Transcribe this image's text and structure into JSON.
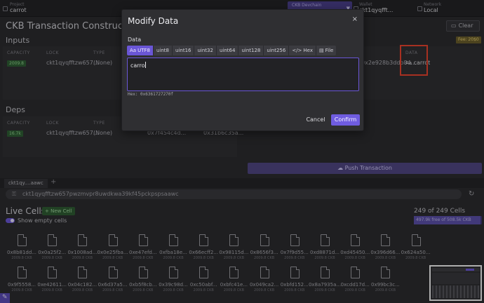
{
  "topbar": {
    "project_label": "Project",
    "project_value": "carrot",
    "connection_label": "CKB Devchain",
    "connection_value": "⋯",
    "wallet_label": "Wallet",
    "wallet_value": "ckt1qyqfft...",
    "network_label": "Network",
    "network_value": "Local"
  },
  "page": {
    "title": "CKB Transaction Constructor",
    "clear_label": "Clear",
    "inputs_label": "Inputs",
    "deps_label": "Deps",
    "fee_badge": "Fee: 20$0",
    "columns": {
      "capacity": "CAPACITY",
      "lock": "LOCK",
      "type": "TYPE",
      "data": "DATA"
    },
    "input_row": {
      "capacity": "2009.8",
      "lock": "ckt1qyqfftzw657...",
      "type": "(None)",
      "hash": "0x2e928b3ddb84...",
      "data_prefix": "Aa",
      "data_value": "carrot"
    },
    "dep_row": {
      "capacity": "16.7k",
      "lock": "ckt1qyqfftzw657...",
      "type": "(None)",
      "hash1": "0x7f454c4d...",
      "hash2": "0x31b6c35a..."
    },
    "push_label": "Push Transaction"
  },
  "explorer": {
    "tab_label": "ckt1qy....aawc",
    "address": "ckt1qyqfftzw657pwzmvpr8uwdkwa39kf45pckpspsaawc",
    "live_cells_title": "Live Cells",
    "new_cell_label": "New Cell",
    "show_empty_label": "Show empty cells",
    "cell_count": "249 of 249 Cells",
    "capacity_text": "497.9k free of 508.5k CKB",
    "capacity_fraction": 0.98,
    "cells_row1": [
      {
        "id": "0x8b81dd...",
        "cap": "2009.8 CKB"
      },
      {
        "id": "0x0a25f2...",
        "cap": "2009.8 CKB"
      },
      {
        "id": "0x1008ad...",
        "cap": "2009.8 CKB"
      },
      {
        "id": "0x0e25fba...",
        "cap": "2009.8 CKB"
      },
      {
        "id": "0xe47efd...",
        "cap": "2009.8 CKB"
      },
      {
        "id": "0xfba18e...",
        "cap": "2009.8 CKB"
      },
      {
        "id": "0x66ecff2...",
        "cap": "2009.8 CKB"
      },
      {
        "id": "0x98115d...",
        "cap": "2009.8 CKB"
      },
      {
        "id": "0x8656f3...",
        "cap": "2009.8 CKB"
      },
      {
        "id": "0x7f9d55...",
        "cap": "2009.8 CKB"
      },
      {
        "id": "0xd8871d...",
        "cap": "2009.8 CKB"
      },
      {
        "id": "0xd45450...",
        "cap": "2009.8 CKB"
      },
      {
        "id": "0x396d66...",
        "cap": "2009.8 CKB"
      },
      {
        "id": "0x624a50...",
        "cap": "2009.8 CKB"
      }
    ],
    "cells_row2": [
      {
        "id": "0x9f5558...",
        "cap": "2009.8 CKB"
      },
      {
        "id": "0xe42611...",
        "cap": "2009.8 CKB"
      },
      {
        "id": "0x04c182...",
        "cap": "2009.8 CKB"
      },
      {
        "id": "0x6d37a5...",
        "cap": "2009.8 CKB"
      },
      {
        "id": "0xb5f8cb...",
        "cap": "2009.8 CKB"
      },
      {
        "id": "0x39c98d...",
        "cap": "2009.8 CKB"
      },
      {
        "id": "0xc50abf...",
        "cap": "2009.8 CKB"
      },
      {
        "id": "0xbfc41e...",
        "cap": "2009.8 CKB"
      },
      {
        "id": "0x049ca2...",
        "cap": "2009.8 CKB"
      },
      {
        "id": "0xbfd152...",
        "cap": "2009.8 CKB"
      },
      {
        "id": "0x8a7935a...",
        "cap": "2009.8 CKB"
      },
      {
        "id": "0xcdd17d...",
        "cap": "2009.8 CKB"
      },
      {
        "id": "0x99bc3c...",
        "cap": "2009.8 CKB"
      }
    ]
  },
  "modal": {
    "title": "Modify Data",
    "close_icon": "×",
    "data_label": "Data",
    "tabs": [
      {
        "prefix": "Aa",
        "label": "UTF8",
        "active": true
      },
      {
        "prefix": "",
        "label": "uint8",
        "active": false
      },
      {
        "prefix": "",
        "label": "uint16",
        "active": false
      },
      {
        "prefix": "",
        "label": "uint32",
        "active": false
      },
      {
        "prefix": "",
        "label": "uint64",
        "active": false
      },
      {
        "prefix": "",
        "label": "uint128",
        "active": false
      },
      {
        "prefix": "",
        "label": "uint256",
        "active": false
      },
      {
        "prefix": "</>",
        "label": "Hex",
        "active": false
      },
      {
        "prefix": "▤",
        "label": "File",
        "active": false
      }
    ],
    "text_value": "carro",
    "hex_line": "Hex: 0x6361727270f",
    "cancel_label": "Cancel",
    "confirm_label": "Confirm"
  },
  "colors": {
    "accent": "#6f5ce0",
    "highlight_box": "#e8432e",
    "capacity_green": "#2f5e34"
  }
}
